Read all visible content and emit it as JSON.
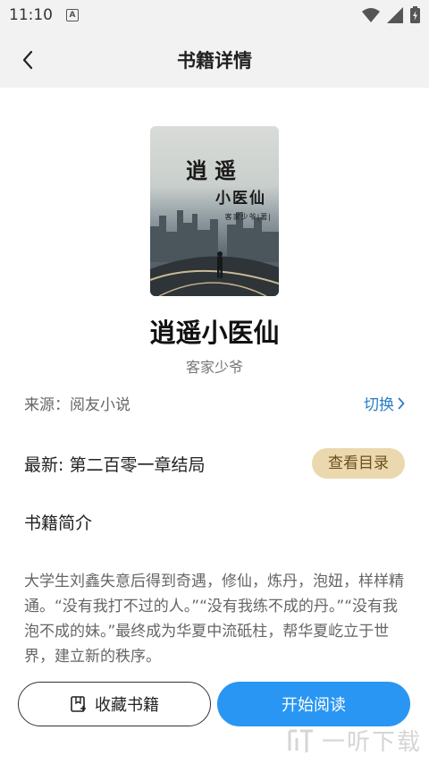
{
  "status_bar": {
    "time": "11:10",
    "notification_badge": "A"
  },
  "app_bar": {
    "title": "书籍详情"
  },
  "book": {
    "cover": {
      "title_text": "逍遥",
      "subtitle_text": "小医仙",
      "author_text": "客家少爷|著|"
    },
    "title": "逍遥小医仙",
    "author": "客家少爷",
    "source": "来源：阅友小说",
    "switch_label": "切换",
    "latest": "最新: 第二百零一章结局",
    "catalog_button": "查看目录",
    "intro_heading": "书籍简介",
    "intro": "大学生刘鑫失意后得到奇遇，修仙，炼丹，泡妞，样样精通。“没有我打不过的人。”“没有我练不成的丹。”“没有我泡不成的妹。”最终成为华夏中流砥柱，帮华夏屹立于世界，建立新的秩序。"
  },
  "actions": {
    "collect_label": "收藏书籍",
    "read_label": "开始阅读"
  },
  "watermark": {
    "text": "一听下载"
  },
  "colors": {
    "accent_blue": "#2996f3",
    "link_blue": "#2a7cc7",
    "catalog_bg": "#ebd8ae"
  }
}
